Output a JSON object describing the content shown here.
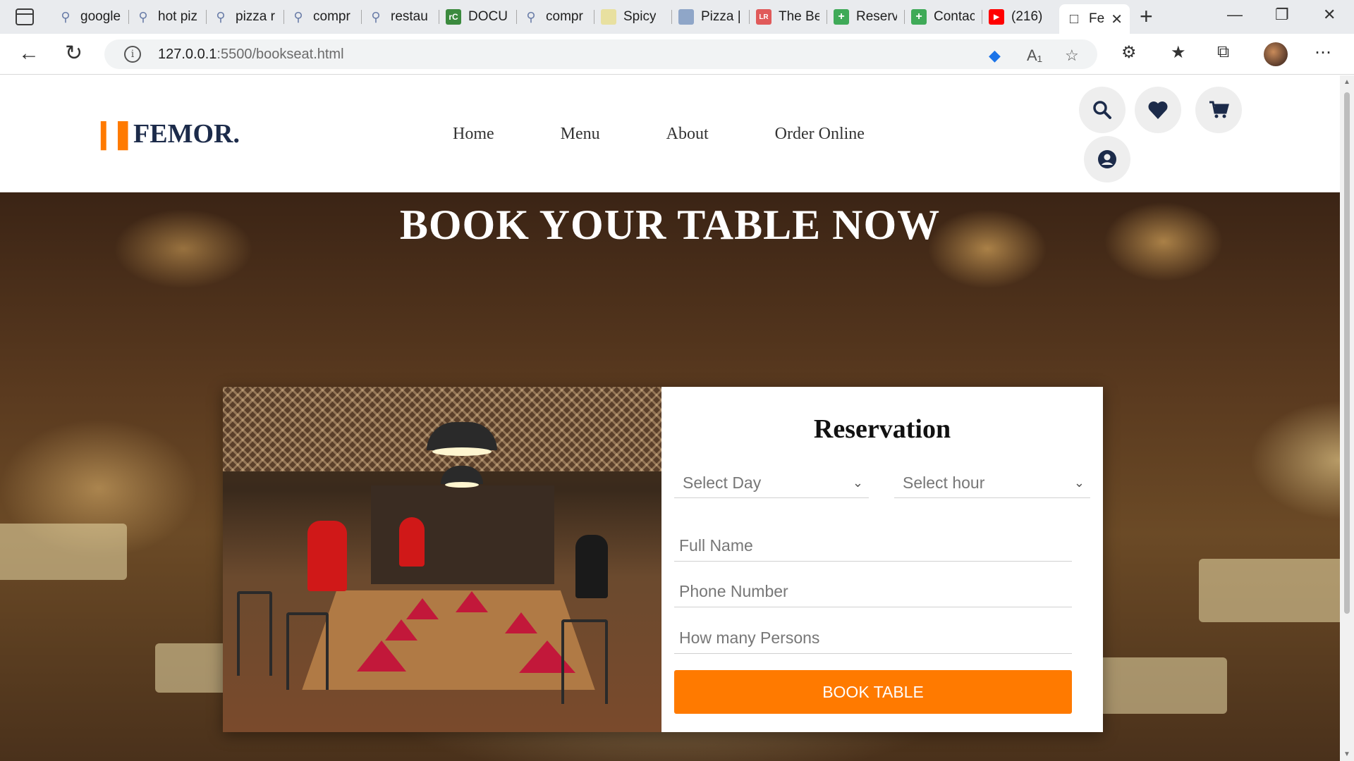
{
  "browser": {
    "tabs": [
      {
        "label": "google",
        "icon": "search-icon"
      },
      {
        "label": "hot piz",
        "icon": "search-icon"
      },
      {
        "label": "pizza r",
        "icon": "search-icon"
      },
      {
        "label": "compr",
        "icon": "search-icon"
      },
      {
        "label": "restau",
        "icon": "search-icon"
      },
      {
        "label": "DOCU",
        "icon": "rc-icon",
        "color": "#3b8a3e"
      },
      {
        "label": "compr",
        "icon": "search-icon"
      },
      {
        "label": "Spicy",
        "icon": "leaf-icon",
        "color": "#e8e0a0"
      },
      {
        "label": "Pizza |",
        "icon": "site-icon",
        "color": "#8fa6c8"
      },
      {
        "label": "The Be",
        "icon": "lr-icon",
        "color": "#e05a5a"
      },
      {
        "label": "Reserv",
        "icon": "plus-icon",
        "color": "#3faa58"
      },
      {
        "label": "Contac",
        "icon": "plus-icon",
        "color": "#3faa58"
      },
      {
        "label": "(216)",
        "icon": "youtube-icon",
        "color": "#ff0000"
      }
    ],
    "active_tab": {
      "label": "Fe",
      "icon": "page-icon"
    },
    "url_host": "127.0.0.1",
    "url_rest": ":5500/bookseat.html"
  },
  "site": {
    "logo": "FEMOR.",
    "nav": [
      "Home",
      "Menu",
      "About",
      "Order Online"
    ],
    "header_icons": [
      "search-icon",
      "heart-icon",
      "cart-icon",
      "user-icon"
    ],
    "accent_color": "#ff7a00",
    "brand_color": "#1c2b4a"
  },
  "hero": {
    "title": "BOOK YOUR TABLE NOW"
  },
  "reservation": {
    "title": "Reservation",
    "day_placeholder": "Select Day",
    "hour_placeholder": "Select hour",
    "name_placeholder": "Full Name",
    "phone_placeholder": "Phone Number",
    "persons_placeholder": "How many Persons",
    "submit_label": "BOOK TABLE"
  }
}
